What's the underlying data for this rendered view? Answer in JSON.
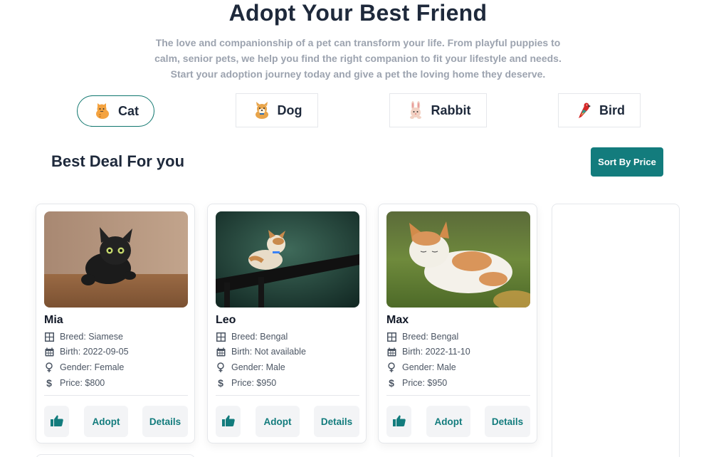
{
  "header": {
    "title": "Adopt Your Best Friend",
    "subtitle": "The love and companionship of a pet can transform your life. From playful puppies to calm, senior pets, we help you find the right companion to fit your lifestyle and needs. Start your adoption journey today and give a pet the loving home they deserve."
  },
  "categories": [
    {
      "label": "Cat",
      "icon": "cat-emoji-icon",
      "active": true
    },
    {
      "label": "Dog",
      "icon": "dog-emoji-icon",
      "active": false
    },
    {
      "label": "Rabbit",
      "icon": "rabbit-emoji-icon",
      "active": false
    },
    {
      "label": "Bird",
      "icon": "parrot-emoji-icon",
      "active": false
    }
  ],
  "section": {
    "title": "Best Deal For you",
    "sort_label": "Sort By Price"
  },
  "pets": [
    {
      "name": "Mia",
      "breed": "Breed: Siamese",
      "birth": "Birth: 2022-09-05",
      "gender": "Gender: Female",
      "price": "Price: $800",
      "adopt": "Adopt",
      "details": "Details"
    },
    {
      "name": "Leo",
      "breed": "Breed: Bengal",
      "birth": "Birth: Not available",
      "gender": "Gender: Male",
      "price": "Price: $950",
      "adopt": "Adopt",
      "details": "Details"
    },
    {
      "name": "Max",
      "breed": "Breed: Bengal",
      "birth": "Birth: 2022-11-10",
      "gender": "Gender: Male",
      "price": "Price: $950",
      "adopt": "Adopt",
      "details": "Details"
    }
  ],
  "colors": {
    "accent": "#137c7d",
    "title": "#1e293b",
    "muted": "#9ca3af"
  }
}
